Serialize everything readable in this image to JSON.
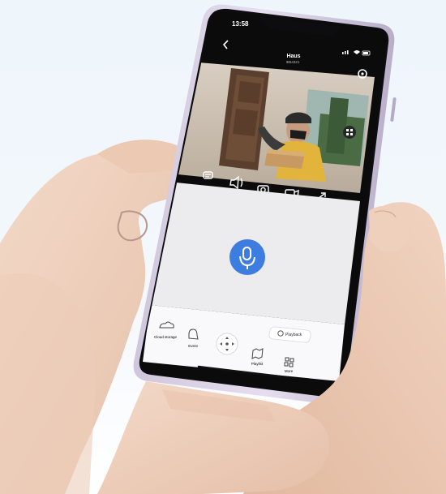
{
  "status_bar": {
    "time": "13:58"
  },
  "header": {
    "title": "Haus",
    "subtitle": "IB54321"
  },
  "video_controls": {
    "icons": [
      "chat-icon",
      "speaker-icon",
      "camera-icon",
      "record-icon",
      "fullscreen-icon"
    ]
  },
  "talk": {
    "icon": "microphone-icon",
    "accent": "#3d7de0"
  },
  "playback": {
    "label": "Playback"
  },
  "bottom_nav": {
    "items": [
      {
        "label": "Cloud storage",
        "icon": "cloud-icon"
      },
      {
        "label": "Event",
        "icon": "alarm-icon"
      },
      {
        "label": "",
        "icon": "ptz-control-icon"
      },
      {
        "label": "Playlist",
        "icon": "map-icon"
      },
      {
        "label": "More",
        "icon": "grid-icon"
      }
    ]
  }
}
